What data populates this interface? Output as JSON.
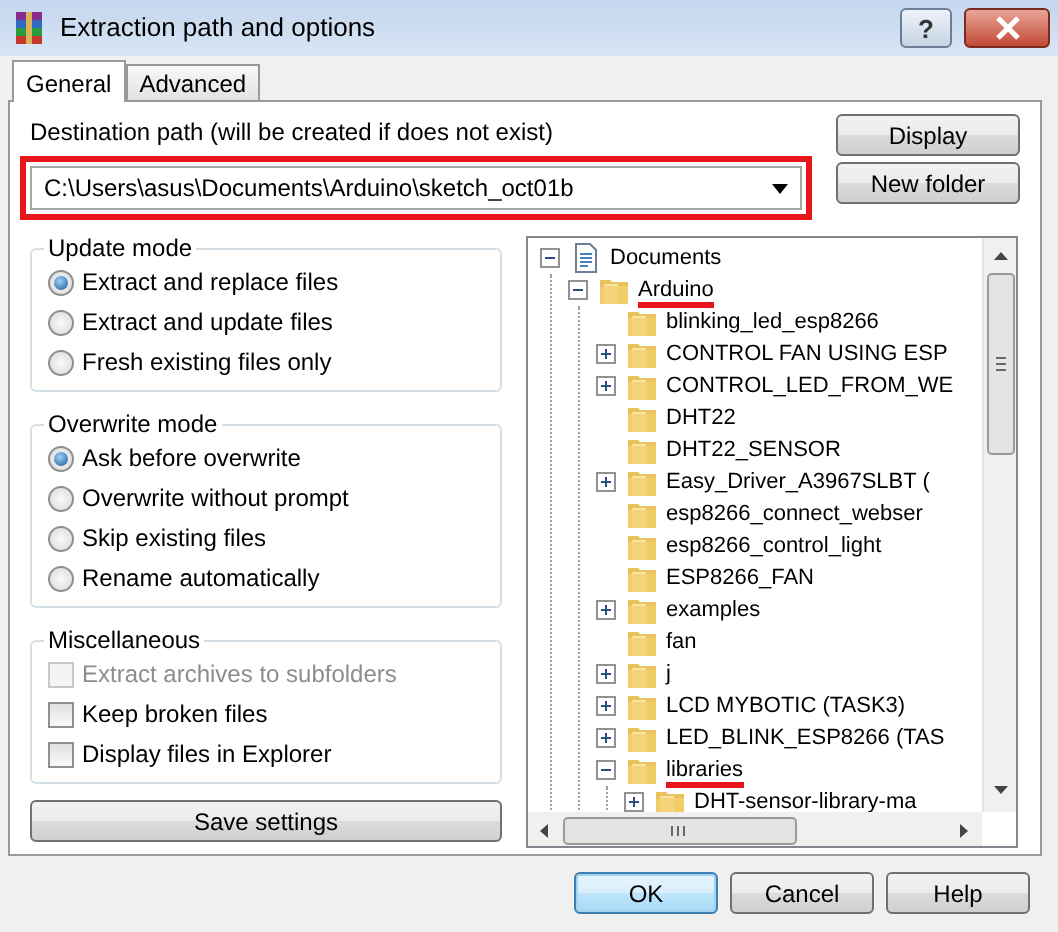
{
  "window": {
    "title": "Extraction path and options",
    "help_label": "?"
  },
  "tabs": [
    {
      "label": "General",
      "selected": true
    },
    {
      "label": "Advanced",
      "selected": false
    }
  ],
  "destination": {
    "label": "Destination path (will be created if does not exist)",
    "value": "C:\\Users\\asus\\Documents\\Arduino\\sketch_oct01b",
    "highlighted": true
  },
  "side_buttons": [
    "Display",
    "New folder"
  ],
  "groups": [
    {
      "title": "Update mode",
      "options": [
        {
          "kind": "radio",
          "label": "Extract and replace files",
          "selected": true
        },
        {
          "kind": "radio",
          "label": "Extract and update files",
          "selected": false
        },
        {
          "kind": "radio",
          "label": "Fresh existing files only",
          "selected": false
        }
      ]
    },
    {
      "title": "Overwrite mode",
      "options": [
        {
          "kind": "radio",
          "label": "Ask before overwrite",
          "selected": true
        },
        {
          "kind": "radio",
          "label": "Overwrite without prompt",
          "selected": false
        },
        {
          "kind": "radio",
          "label": "Skip existing files",
          "selected": false
        },
        {
          "kind": "radio",
          "label": "Rename automatically",
          "selected": false
        }
      ]
    },
    {
      "title": "Miscellaneous",
      "options": [
        {
          "kind": "checkbox",
          "label": "Extract archives to subfolders",
          "checked": false,
          "disabled": true
        },
        {
          "kind": "checkbox",
          "label": "Keep broken files",
          "checked": false,
          "disabled": false
        },
        {
          "kind": "checkbox",
          "label": "Display files in Explorer",
          "checked": false,
          "disabled": false
        }
      ]
    }
  ],
  "save_button": "Save settings",
  "tree": [
    {
      "label": "Documents",
      "kind": "documents",
      "expanded": true,
      "underlined": false,
      "children": [
        {
          "label": "Arduino",
          "kind": "folder",
          "expanded": true,
          "underlined": true,
          "children": [
            {
              "label": "blinking_led_esp8266",
              "kind": "folder",
              "underlined": false
            },
            {
              "label": "CONTROL FAN USING ESP",
              "kind": "folder",
              "expanded": false,
              "underlined": false
            },
            {
              "label": "CONTROL_LED_FROM_WE",
              "kind": "folder",
              "expanded": false,
              "underlined": false
            },
            {
              "label": "DHT22",
              "kind": "folder",
              "underlined": false
            },
            {
              "label": "DHT22_SENSOR",
              "kind": "folder",
              "underlined": false
            },
            {
              "label": "Easy_Driver_A3967SLBT (",
              "kind": "folder",
              "expanded": false,
              "underlined": false
            },
            {
              "label": "esp8266_connect_webser",
              "kind": "folder",
              "underlined": false
            },
            {
              "label": "esp8266_control_light",
              "kind": "folder",
              "underlined": false
            },
            {
              "label": "ESP8266_FAN",
              "kind": "folder",
              "underlined": false
            },
            {
              "label": "examples",
              "kind": "folder",
              "expanded": false,
              "underlined": false
            },
            {
              "label": "fan",
              "kind": "folder",
              "underlined": false
            },
            {
              "label": "j",
              "kind": "folder",
              "expanded": false,
              "underlined": false
            },
            {
              "label": "LCD MYBOTIC (TASK3)",
              "kind": "folder",
              "expanded": false,
              "underlined": false
            },
            {
              "label": "LED_BLINK_ESP8266 (TAS",
              "kind": "folder",
              "expanded": false,
              "underlined": false
            },
            {
              "label": "libraries",
              "kind": "folder",
              "expanded": true,
              "underlined": true,
              "children": [
                {
                  "label": "DHT-sensor-library-ma",
                  "kind": "folder",
                  "expanded": false,
                  "underlined": false
                }
              ]
            }
          ]
        }
      ]
    }
  ],
  "footer_buttons": [
    {
      "label": "OK",
      "default": true
    },
    {
      "label": "Cancel",
      "default": false
    },
    {
      "label": "Help",
      "default": false
    }
  ]
}
